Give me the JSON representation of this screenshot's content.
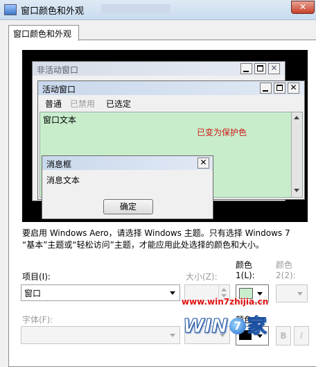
{
  "window": {
    "title": "窗口颜色和外观",
    "close_glyph": "✕"
  },
  "tabs": [
    {
      "label": "窗口颜色和外观"
    }
  ],
  "preview": {
    "inactive_window": {
      "title": "非活动窗口"
    },
    "active_window": {
      "title": "活动窗口",
      "menu": [
        "普通",
        "已禁用",
        "已选定"
      ],
      "text": "窗口文本",
      "annotation": "已变为保护色"
    },
    "message_box": {
      "title": "消息框",
      "text": "消息文本",
      "ok_label": "确定"
    }
  },
  "description": "要启用 Windows Aero，请选择 Windows 主题。只有选择 Windows 7 “基本”主题或“轻松访问”主题，才能应用此处选择的颜色和大小。",
  "controls": {
    "item_label": "项目(I):",
    "item_value": "窗口",
    "size_label": "大小(Z):",
    "color1_label": "颜色",
    "color1_sub": "1(L):",
    "color2_label": "颜色",
    "color2_sub": "2(2):",
    "font_label": "字体(F):",
    "color_label": "颜色",
    "color1_swatch": "#c8edcb"
  },
  "watermark": {
    "url": "www.win7zhijia.cn",
    "brand_a": "WIN",
    "brand_b": "7",
    "brand_c": "家"
  }
}
